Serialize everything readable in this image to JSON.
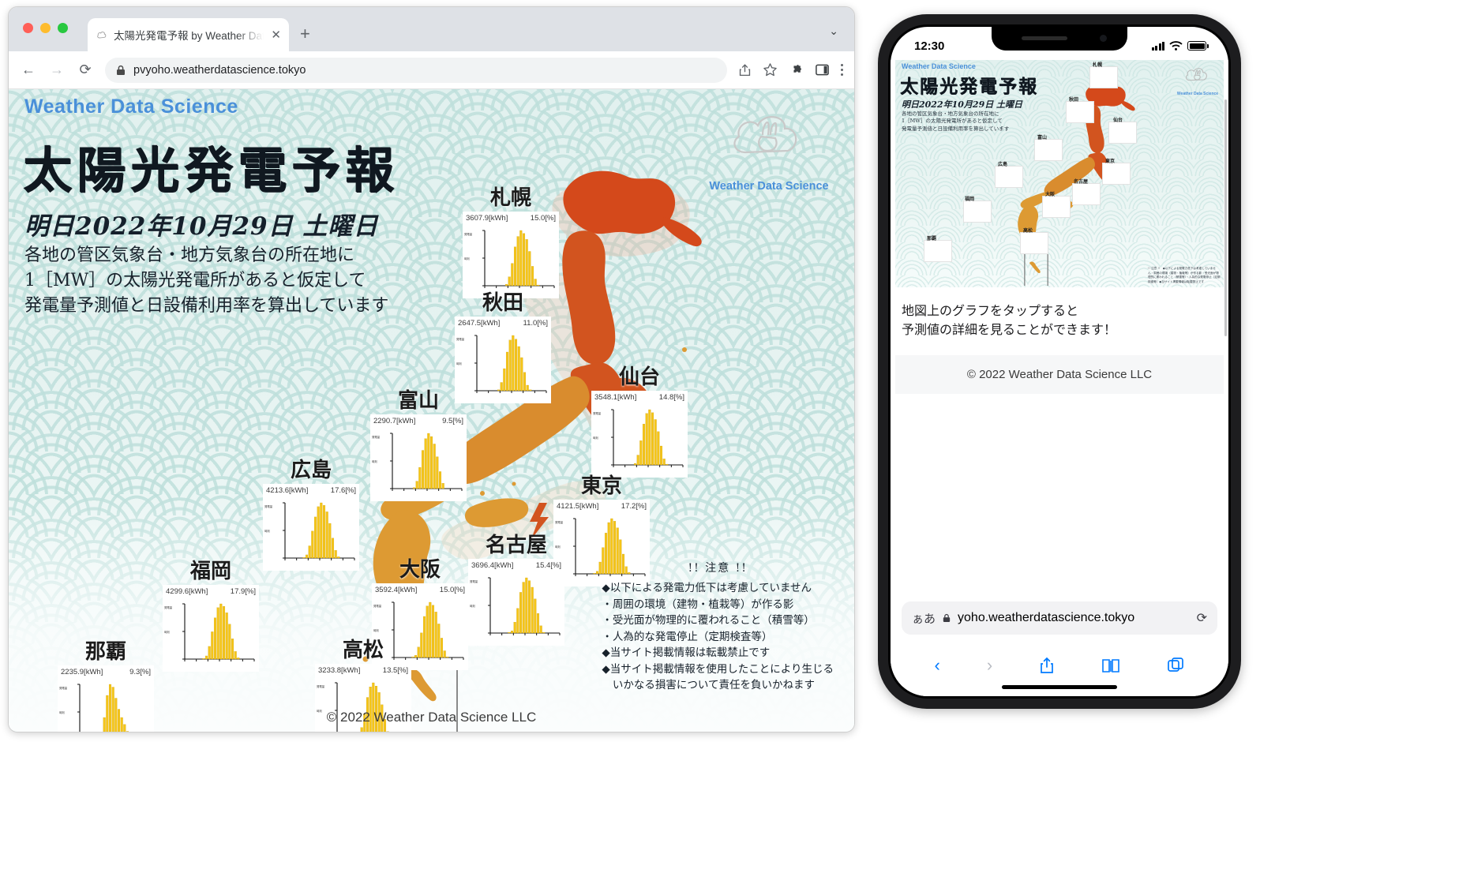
{
  "browser": {
    "tab_title": "太陽光発電予報 by Weather Data",
    "tab_close": "✕",
    "new_tab": "+",
    "tab_list_caret": "⌄",
    "back": "←",
    "forward": "→",
    "reload": "⟳",
    "lock_icon": "lock-icon",
    "url": "pvyoho.weatherdatascience.tokyo",
    "share_icon": "share-icon",
    "bookmark_icon": "star-icon",
    "extensions_icon": "puzzle-icon",
    "sidepanel_icon": "side-panel-icon",
    "menu_icon": "kebab-menu-icon"
  },
  "page": {
    "brand": "Weather Data Science",
    "title": "太陽光発電予報",
    "date_line": "明日2022年10月29日 土曜日",
    "description_lines": [
      "各地の管区気象台・地方気象台の所在地に",
      "1［MW］の太陽光発電所があると仮定して",
      "発電量予測値と日設備利用率を算出しています"
    ],
    "logo_label": "Weather Data Science",
    "footer": "© 2022 Weather Data Science LLC",
    "notes": {
      "heading": "!! 注意 !!",
      "lines": [
        "◆以下による発電力低下は考慮していません",
        "・周囲の環境（建物・植栽等）が作る影",
        "・受光面が物理的に覆われること（積雪等）",
        "・人為的な発電停止（定期検査等）",
        "◆当サイト掲載情報は転載禁止です",
        "◆当サイト掲載情報を使用したことにより生じる",
        "　いかなる損害について責任を負いかねます"
      ]
    },
    "units": {
      "energy": "[kWh]",
      "rate": "[%]"
    },
    "colors": {
      "bg_teal": "#e2f1ef",
      "wave": "#bfe0dc",
      "brand_blue": "#4a90d9",
      "map_north": "#d4491b",
      "map_south": "#dd9a33",
      "bar_yellow": "#f5c518"
    }
  },
  "chart_data": [
    {
      "type": "bar",
      "title": "札幌",
      "value_kwh": "3607.9[kWh]",
      "rate": "15.0[%]",
      "ylabel": "発電量",
      "xlabel": "時刻",
      "values": [
        0,
        0,
        0,
        0,
        0,
        0,
        0,
        2,
        12,
        30,
        52,
        66,
        74,
        70,
        62,
        46,
        26,
        9,
        1,
        0,
        0,
        0,
        0,
        0
      ]
    },
    {
      "type": "bar",
      "title": "秋田",
      "value_kwh": "2647.5[kWh]",
      "rate": "11.0[%]",
      "ylabel": "発電量",
      "xlabel": "時刻",
      "values": [
        0,
        0,
        0,
        0,
        0,
        0,
        0,
        1,
        9,
        24,
        42,
        55,
        60,
        56,
        48,
        36,
        20,
        6,
        1,
        0,
        0,
        0,
        0,
        0
      ]
    },
    {
      "type": "bar",
      "title": "仙台",
      "value_kwh": "3548.1[kWh]",
      "rate": "14.8[%]",
      "ylabel": "発電量",
      "xlabel": "時刻",
      "values": [
        0,
        0,
        0,
        0,
        0,
        0,
        0,
        2,
        13,
        32,
        54,
        68,
        73,
        69,
        60,
        44,
        25,
        8,
        1,
        0,
        0,
        0,
        0,
        0
      ]
    },
    {
      "type": "bar",
      "title": "富山",
      "value_kwh": "2290.7[kWh]",
      "rate": "9.5[%]",
      "ylabel": "発電量",
      "xlabel": "時刻",
      "values": [
        0,
        0,
        0,
        0,
        0,
        0,
        0,
        1,
        7,
        20,
        36,
        47,
        52,
        49,
        42,
        30,
        16,
        5,
        0,
        0,
        0,
        0,
        0,
        0
      ]
    },
    {
      "type": "bar",
      "title": "東京",
      "value_kwh": "4121.5[kWh]",
      "rate": "17.2[%]",
      "ylabel": "発電量",
      "xlabel": "時刻",
      "values": [
        0,
        0,
        0,
        0,
        0,
        0,
        1,
        4,
        18,
        40,
        62,
        78,
        84,
        80,
        70,
        52,
        30,
        11,
        2,
        0,
        0,
        0,
        0,
        0
      ]
    },
    {
      "type": "bar",
      "title": "広島",
      "value_kwh": "4213.6[kWh]",
      "rate": "17.6[%]",
      "ylabel": "発電量",
      "xlabel": "時刻",
      "values": [
        0,
        0,
        0,
        0,
        0,
        0,
        1,
        5,
        19,
        42,
        64,
        80,
        86,
        82,
        72,
        54,
        31,
        12,
        2,
        0,
        0,
        0,
        0,
        0
      ]
    },
    {
      "type": "bar",
      "title": "名古屋",
      "value_kwh": "3696.4[kWh]",
      "rate": "15.4[%]",
      "ylabel": "発電量",
      "xlabel": "時刻",
      "values": [
        0,
        0,
        0,
        0,
        0,
        0,
        1,
        3,
        15,
        34,
        56,
        70,
        76,
        72,
        63,
        47,
        27,
        10,
        1,
        0,
        0,
        0,
        0,
        0
      ]
    },
    {
      "type": "bar",
      "title": "大阪",
      "value_kwh": "3592.4[kWh]",
      "rate": "15.0[%]",
      "ylabel": "発電量",
      "xlabel": "時刻",
      "values": [
        0,
        0,
        0,
        0,
        0,
        0,
        1,
        3,
        14,
        33,
        55,
        69,
        74,
        70,
        61,
        45,
        26,
        9,
        1,
        0,
        0,
        0,
        0,
        0
      ]
    },
    {
      "type": "bar",
      "title": "福岡",
      "value_kwh": "4299.6[kWh]",
      "rate": "17.9[%]",
      "ylabel": "発電量",
      "xlabel": "時刻",
      "values": [
        0,
        0,
        0,
        0,
        0,
        0,
        1,
        5,
        20,
        43,
        65,
        81,
        87,
        83,
        73,
        55,
        32,
        12,
        2,
        0,
        0,
        0,
        0,
        0
      ]
    },
    {
      "type": "bar",
      "title": "高松",
      "value_kwh": "3233.8[kWh]",
      "rate": "13.5[%]",
      "ylabel": "発電量",
      "xlabel": "時刻",
      "values": [
        0,
        0,
        0,
        0,
        0,
        0,
        1,
        3,
        13,
        30,
        50,
        63,
        68,
        64,
        56,
        41,
        23,
        8,
        1,
        0,
        0,
        0,
        0,
        0
      ]
    },
    {
      "type": "bar",
      "title": "那覇",
      "value_kwh": "2235.9[kWh]",
      "rate": "9.3[%]",
      "ylabel": "発電量",
      "xlabel": "時刻",
      "values": [
        0,
        0,
        0,
        0,
        0,
        0,
        1,
        4,
        16,
        32,
        40,
        38,
        30,
        22,
        16,
        11,
        6,
        2,
        0,
        0,
        0,
        0,
        0,
        0
      ]
    }
  ],
  "phone": {
    "status": {
      "time": "12:30",
      "signal_icon": "cellular-bars-icon",
      "wifi_icon": "wifi-icon",
      "battery_icon": "battery-icon"
    },
    "tap_info_lines": [
      "地図上のグラフをタップすると",
      "予測値の詳細を見ることができます！"
    ],
    "footer": "© 2022 Weather Data Science LLC",
    "safari": {
      "aa_label": "ぁあ",
      "lock_icon": "lock-icon",
      "url": "yoho.weatherdatascience.tokyo",
      "reload_icon": "reload-icon",
      "back_icon": "chevron-left-icon",
      "forward_icon": "chevron-right-icon",
      "share_icon": "share-icon",
      "bookmarks_icon": "book-icon",
      "tabs_icon": "tabs-icon"
    },
    "mini": {
      "brand": "Weather Data Science",
      "title": "太陽光発電予報",
      "date_line": "明日2022年10月29日 土曜日",
      "desc_lines": [
        "各地の管区気象台・地方気象台の所在地に",
        "1［MW］の太陽光発電所があると仮定して",
        "発電量予測値と日設備利用率を算出しています"
      ],
      "logo_label": "Weather Data Science",
      "cities": [
        "札幌",
        "秋田",
        "仙台",
        "富山",
        "東京",
        "広島",
        "名古屋",
        "大阪",
        "福岡",
        "高松",
        "那覇"
      ],
      "note": "!! 注意 !!　◆以下による発電力低下は考慮していません・周囲の環境（建物・植栽等）が作る影・受光面が物理的に覆われること（積雪等）・人為的な発電停止（定期検査等）◆当サイト掲載情報は転載禁止です"
    }
  }
}
